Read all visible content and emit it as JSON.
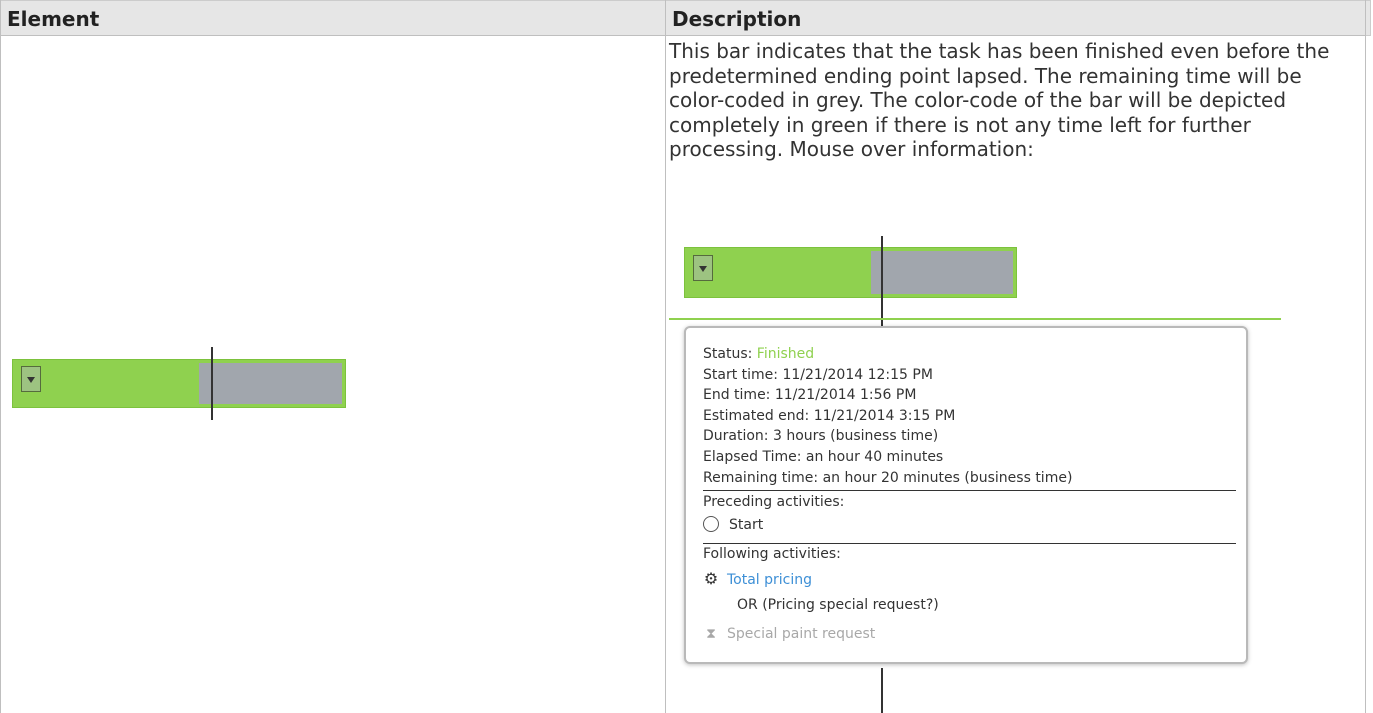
{
  "table": {
    "headers": [
      "Element",
      "Description"
    ]
  },
  "description": {
    "text": "This bar indicates that the task has been finished even before the predetermined ending point lapsed. The remaining time will be color-coded in grey. The color-code of the bar will be depicted completely in green if there is not any time left for further processing. Mouse over information:"
  },
  "colors": {
    "finished_green": "#8fd14f",
    "remaining_grey": "#a1a6ad",
    "link_blue": "#3d8fd6"
  },
  "icons": {
    "dropdown": "chevron-down-icon",
    "preceding": "circle-icon",
    "following_running": "gear-icon",
    "following_waiting": "hourglass-icon"
  },
  "tooltip": {
    "status_label": "Status: ",
    "status_value": "Finished",
    "start_time": "Start time: 11/21/2014 12:15 PM",
    "end_time": "End time: 11/21/2014 1:56 PM",
    "estimated_end": "Estimated end: 11/21/2014 3:15 PM",
    "duration": "Duration: 3 hours (business time)",
    "elapsed_time": "Elapsed Time: an hour 40 minutes",
    "remaining_time": "Remaining time: an hour 20 minutes (business time)",
    "preceding_label": "Preceding activities:",
    "preceding_items": [
      "Start"
    ],
    "following_label": "Following activities:",
    "following_items": [
      "Total pricing",
      "OR (Pricing special request?)",
      "Special paint request"
    ]
  }
}
